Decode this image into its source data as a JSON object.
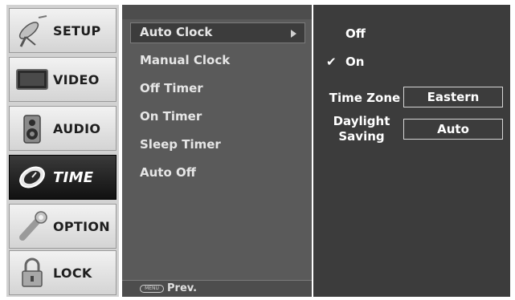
{
  "tabs": [
    {
      "label": "SETUP",
      "icon": "satellite-dish-icon"
    },
    {
      "label": "VIDEO",
      "icon": "monitor-icon"
    },
    {
      "label": "AUDIO",
      "icon": "speaker-icon"
    },
    {
      "label": "TIME",
      "icon": "clock-icon"
    },
    {
      "label": "OPTION",
      "icon": "wrench-icon"
    },
    {
      "label": "LOCK",
      "icon": "padlock-icon"
    }
  ],
  "active_tab": "TIME",
  "menu": {
    "items": [
      "Auto Clock",
      "Manual Clock",
      "Off Timer",
      "On Timer",
      "Sleep Timer",
      "Auto Off"
    ],
    "selected": "Auto Clock",
    "footer_button": "MENU",
    "footer_label": "Prev."
  },
  "settings": {
    "options": [
      "Off",
      "On"
    ],
    "checked": "On",
    "time_zone_label": "Time Zone",
    "time_zone_value": "Eastern",
    "daylight_label_line1": "Daylight",
    "daylight_label_line2": "Saving",
    "daylight_value": "Auto"
  },
  "colors": {
    "menu_panel": "#5a5a5a",
    "settings_panel": "#3c3c3c",
    "active_tab": "#111111"
  }
}
